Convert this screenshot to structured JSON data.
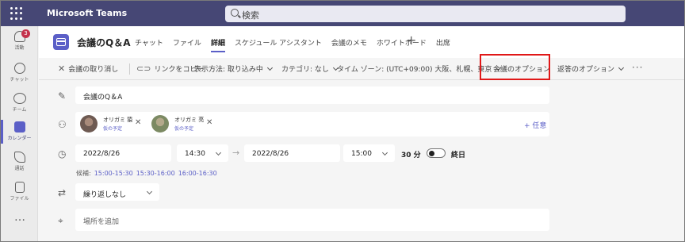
{
  "app": {
    "name": "Microsoft Teams"
  },
  "search": {
    "placeholder": "検索"
  },
  "rail": {
    "items": [
      {
        "label": "活動",
        "icon": "bell-icon",
        "badge": "3"
      },
      {
        "label": "チャット",
        "icon": "chat-icon"
      },
      {
        "label": "チーム",
        "icon": "teams-icon"
      },
      {
        "label": "カレンダー",
        "icon": "calendar-icon",
        "active": true
      },
      {
        "label": "通話",
        "icon": "phone-icon"
      },
      {
        "label": "ファイル",
        "icon": "file-icon"
      }
    ],
    "more": "…"
  },
  "header": {
    "title": "会議のQ＆A",
    "tabs": [
      "チャット",
      "ファイル",
      "詳細",
      "スケジュール アシスタント",
      "会議のメモ",
      "ホワイトボード",
      "出席"
    ],
    "active_tab": "詳細",
    "add": "+"
  },
  "toolbar": {
    "cancel": "会議の取り消し",
    "copy_link": "リンクをコピー",
    "show_as": "表示方法: 取り込み中",
    "category": "カテゴリ: なし",
    "timezone": "タイム ゾーン: (UTC+09:00) 大阪、札幌、東京",
    "meeting_options": "会議のオプション",
    "response_options": "返答のオプション",
    "more": "···"
  },
  "form": {
    "title_value": "会議のQ＆A",
    "attendees": [
      {
        "name": "オリガミ 猿",
        "status": "仮の予定"
      },
      {
        "name": "オリガミ 亮",
        "status": "仮の予定"
      }
    ],
    "optional": "+ 任意",
    "start_date": "2022/8/26",
    "start_time": "14:30",
    "end_date": "2022/8/26",
    "end_time": "15:00",
    "duration": "30 分",
    "all_day": "終日",
    "suggestions_label": "候補:",
    "suggestions": [
      "15:00-15:30",
      "15:30-16:00",
      "16:00-16:30"
    ],
    "repeat": "繰り返しなし",
    "location_placeholder": "場所を追加"
  },
  "colors": {
    "topbar": "#464775",
    "accent": "#5b5fc7",
    "highlight": "#e01818",
    "badge": "#c4314b"
  }
}
